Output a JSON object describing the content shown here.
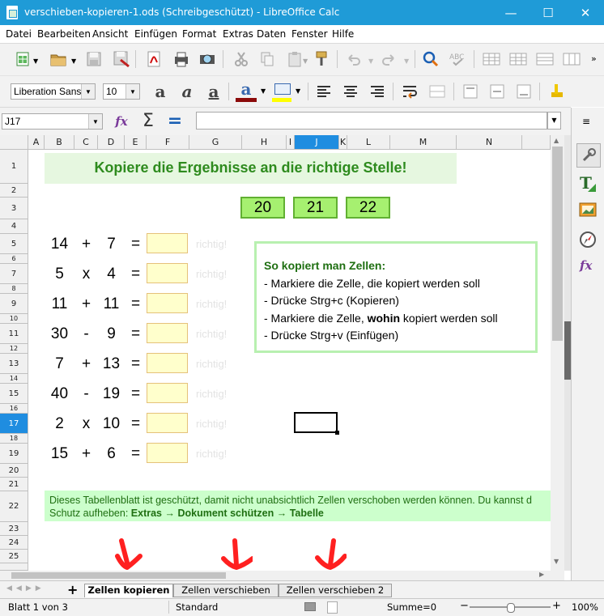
{
  "window": {
    "title": "verschieben-kopieren-1.ods (Schreibgeschützt) - LibreOffice Calc",
    "minimize": "—",
    "maximize": "☐",
    "close": "✕"
  },
  "menu": [
    "Datei",
    "Bearbeiten",
    "Ansicht",
    "Einfügen",
    "Format",
    "Extras",
    "Daten",
    "Fenster",
    "Hilfe"
  ],
  "formatting": {
    "font_name": "Liberation Sans",
    "font_size": "10"
  },
  "formula_bar": {
    "name_box": "J17",
    "content": ""
  },
  "columns": [
    "A",
    "B",
    "C",
    "D",
    "E",
    "F",
    "G",
    "H",
    "I",
    "J",
    "K",
    "L",
    "M",
    "N"
  ],
  "rows": [
    "1",
    "2",
    "3",
    "4",
    "5",
    "6",
    "7",
    "8",
    "9",
    "10",
    "11",
    "12",
    "13",
    "14",
    "15",
    "16",
    "17",
    "18",
    "19",
    "20",
    "21",
    "22",
    "23",
    "24",
    "25"
  ],
  "selected_cell": {
    "column": "J",
    "row": "17"
  },
  "sheet": {
    "heading": "Kopiere die Ergebnisse an die richtige Stelle!",
    "answers": [
      "20",
      "21",
      "22"
    ],
    "tasks": [
      {
        "a": "14",
        "op": "+",
        "b": "7",
        "eq": "=",
        "hint": "richtig!"
      },
      {
        "a": "5",
        "op": "x",
        "b": "4",
        "eq": "=",
        "hint": "richtig!"
      },
      {
        "a": "11",
        "op": "+",
        "b": "11",
        "eq": "=",
        "hint": "richtig!"
      },
      {
        "a": "30",
        "op": "-",
        "b": "9",
        "eq": "=",
        "hint": "richtig!"
      },
      {
        "a": "7",
        "op": "+",
        "b": "13",
        "eq": "=",
        "hint": "richtig!"
      },
      {
        "a": "40",
        "op": "-",
        "b": "19",
        "eq": "=",
        "hint": "richtig!"
      },
      {
        "a": "2",
        "op": "x",
        "b": "10",
        "eq": "=",
        "hint": "richtig!"
      },
      {
        "a": "15",
        "op": "+",
        "b": "6",
        "eq": "=",
        "hint": "richtig!"
      }
    ],
    "instructions": {
      "title": "So kopiert man Zellen:",
      "line1": "- Markiere die Zelle, die kopiert werden soll",
      "line2": "- Drücke Strg+c (Kopieren)",
      "line3_pre": "- Markiere die Zelle, ",
      "line3_bold": "wohin",
      "line3_post": " kopiert werden soll",
      "line4": "- Drücke Strg+v (Einfügen)"
    },
    "note": {
      "line1": "Dieses Tabellenblatt ist geschützt, damit nicht unabsichtlich Zellen verschoben werden können. Du kannst d",
      "line2_pre": "Schutz aufheben: ",
      "path1": "Extras",
      "arrow": "→",
      "path2": "Dokument schützen",
      "path3": "Tabelle"
    }
  },
  "tabs": {
    "add": "+",
    "items": [
      "Zellen kopieren",
      "Zellen verschieben",
      "Zellen verschieben 2"
    ],
    "active_index": 0
  },
  "status": {
    "sheet": "Blatt 1 von 3",
    "style": "Standard",
    "sum": "Summe=0",
    "zoom_minus": "−",
    "zoom_plus": "+",
    "zoom": "100%",
    "zoom_level_percent": 100
  },
  "colors": {
    "titlebar": "#1f9bd7",
    "heading_text": "#2e8b1e",
    "heading_bg": "#e6f7e0",
    "note_bg": "#ccffcc",
    "note_text": "#1f6f12",
    "selection": "#1f8de0",
    "arrow": "#ff2020"
  }
}
